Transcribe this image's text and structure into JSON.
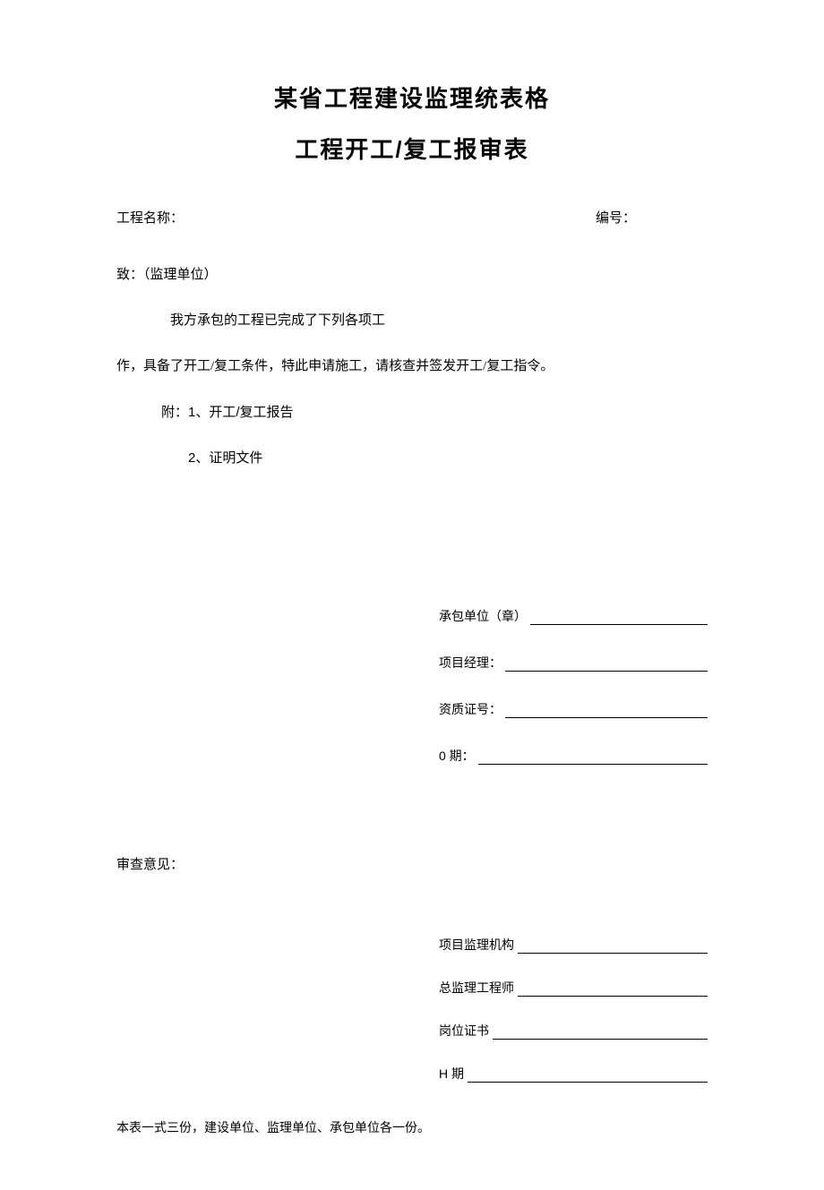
{
  "title1": "某省工程建设监理统表格",
  "title2": "工程开工/复工报审表",
  "header": {
    "project_name_label": "工程名称：",
    "serial_label": "编号："
  },
  "body": {
    "to_line": "致：（监理单位）",
    "para1": "我方承包的工程已完成了下列各项工",
    "para2": "作，具备了开工/复工条件，特此申请施工，请核查并签发开工/复工指令。",
    "attach_label": "附：1、开工/复工报告",
    "attach_2": "2、证明文件"
  },
  "sign1": {
    "contractor_label": "承包单位（章）",
    "pm_label": "项目经理：",
    "cert_label": "资质证号：",
    "date_label": "0 期："
  },
  "review_label": "审查意见：",
  "sign2": {
    "supervision_label": "项目监理机构",
    "chief_label": "总监理工程师",
    "position_cert_label": "岗位证书",
    "date_label": "H 期"
  },
  "footer": "本表一式三份，建设单位、监理单位、承包单位各一份。"
}
